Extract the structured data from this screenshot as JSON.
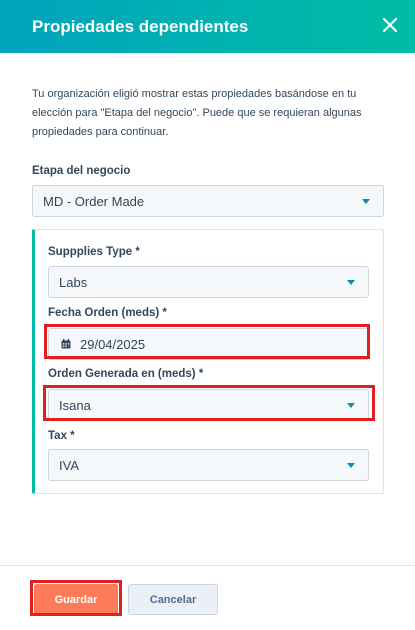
{
  "dialog": {
    "title": "Propiedades dependientes",
    "close_icon": "close-icon"
  },
  "intro_text": "Tu organización eligió mostrar estas propiedades basándose en tu elección para \"Etapa del negocio\". Puede que se requieran algunas propiedades para continuar.",
  "stage": {
    "label": "Etapa del negocio",
    "value": "MD - Order Made"
  },
  "dependent_fields": {
    "supplies_type": {
      "label": "Suppplies Type *",
      "value": "Labs"
    },
    "fecha_orden": {
      "label": "Fecha Orden (meds) *",
      "value": "29/04/2025",
      "icon": "calendar-icon"
    },
    "orden_generada": {
      "label": "Orden Generada en (meds) *",
      "value": "Isana"
    },
    "tax": {
      "label": "Tax  *",
      "value": "IVA"
    }
  },
  "footer": {
    "save_label": "Guardar",
    "cancel_label": "Cancelar"
  },
  "colors": {
    "header_gradient_start": "#00a4bd",
    "header_gradient_end": "#00bda5",
    "primary_button": "#ff7a59",
    "highlight": "#e02020",
    "caret": "#0091ae"
  }
}
